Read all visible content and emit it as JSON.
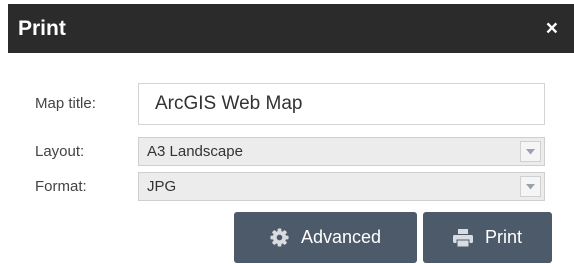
{
  "dialog": {
    "title": "Print",
    "close_label": "×"
  },
  "form": {
    "map_title": {
      "label": "Map title:",
      "value": "ArcGIS Web Map"
    },
    "layout": {
      "label": "Layout:",
      "selected": "A3 Landscape"
    },
    "format": {
      "label": "Format:",
      "selected": "JPG"
    }
  },
  "buttons": {
    "advanced": {
      "label": "Advanced",
      "icon": "gear-icon"
    },
    "print": {
      "label": "Print",
      "icon": "printer-icon"
    }
  },
  "colors": {
    "header_bg": "#2b2b2b",
    "button_bg": "#4d5a69",
    "select_bg": "#ececec"
  }
}
